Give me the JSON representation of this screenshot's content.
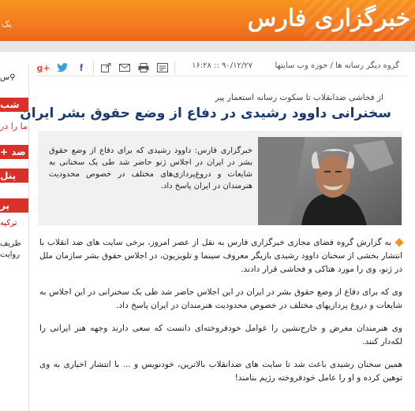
{
  "header": {
    "logo_text": "خبرگزاری فارس",
    "left_edge_text": "یک"
  },
  "colors": {
    "header": "#f47a1f",
    "title": "#1a3a73",
    "accent_red": "#d9312a",
    "lead_bg": "#f1f1f1"
  },
  "sidebar": {
    "items": [
      {
        "text": "س",
        "icon": "search-icon"
      },
      {
        "text": "شب"
      },
      {
        "text": "ما را در"
      },
      {
        "text": "ضد +"
      },
      {
        "text": "پنل"
      },
      {
        "text": "پر"
      },
      {
        "text": "ترکیه"
      },
      {
        "text": "ظریف"
      },
      {
        "text": "روایت"
      }
    ]
  },
  "toolbar": {
    "breadcrumb": "گروه دیگر رسانه ها / حوزه وب سایتها",
    "datetime": "۹۰/۱۲/۲۷ :: ۱۶:۲۸",
    "icons": [
      "save-icon",
      "print-icon",
      "email-icon",
      "share-icon",
      "facebook-icon",
      "twitter-icon",
      "google-plus-icon"
    ]
  },
  "article": {
    "kicker": "از فحاشی ضدانقلاب تا سکوت رسانه استعمار پیر",
    "title": "سخنرانی داوود رشیدی در دفاع از وضع حقوق بشر ایران",
    "lead": "خبرگزاری فارس: داوود رشیدی که برای دفاع از وضع حقوق بشر در ایران در اجلاس ژنو حاضر شد طی یک سخنانی به شایعات و دروغ‌پردازی‌های مختلف در خصوص محدودیت هنرمندان در ایران پاسخ داد.",
    "paragraphs": [
      "به گزارش گروه فضای مجازی خبرگزاری فارس به نقل از عصر امروز، برخی سایت های ضد انقلاب با انتشار بخشی از سخنان داوود رشیدی بازیگر معروف سینما و تلویزیون، در اجلاس حقوق بشر سازمان ملل در ژنو، وی را مورد هتاکی و فحاشی قرار دادند.",
      "وی که برای دفاع از وضع حقوق بشر در ایران در این اجلاس حاضر شد طی یک سخنرانی در این اجلاس به شایعات و دروغ پردازیهای مختلف در خصوص محدودیت هنرمندان در ایران پاسخ داد.",
      "وی هنرمندان مغرض و خارج‌نشین را عوامل خودفروخته‌ای دانست که سعی دارند وجهه هنر ایرانی را لکه‌دار کنند.",
      "همین سخنان رشیدی باعث شد تا سایت های ضدانقلاب بالاترین، خودنویس و ... با انتشار اخباری به وی توهین کرده و او را عامل خودفروخته رژیم بنامند!"
    ]
  }
}
